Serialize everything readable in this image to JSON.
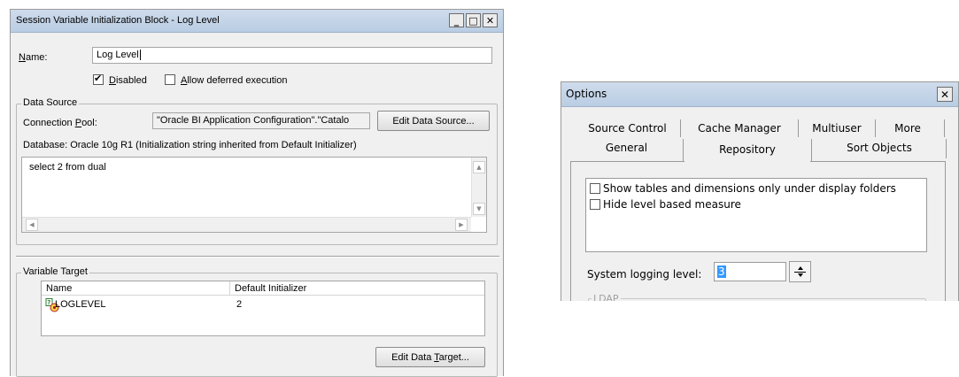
{
  "left_dialog": {
    "title": "Session Variable Initialization Block - Log Level",
    "name_label": "Name:",
    "name_value": "Log Level",
    "disabled_label": "Disabled",
    "disabled_checked": true,
    "deferred_label": "Allow deferred execution",
    "deferred_checked": false,
    "data_source": {
      "group_label": "Data Source",
      "connection_pool_label": "Connection Pool:",
      "connection_pool_value": "\"Oracle BI Application Configuration\".\"Catalo",
      "edit_button": "Edit Data Source...",
      "database_info": "Database: Oracle 10g R1 (Initialization string inherited from Default Initializer)",
      "sql_text": "select 2 from dual"
    },
    "variable_target": {
      "group_label": "Variable Target",
      "columns": [
        "Name",
        "Default Initializer"
      ],
      "rows": [
        {
          "name": "LOGLEVEL",
          "default_initializer": "2"
        }
      ],
      "edit_button": "Edit Data Target..."
    }
  },
  "right_dialog": {
    "title": "Options",
    "tabs_back": [
      "Source Control",
      "Cache Manager",
      "Multiuser",
      "More"
    ],
    "tabs_front": [
      "General",
      "Repository",
      "Sort Objects"
    ],
    "active_tab": "Repository",
    "options": [
      {
        "label": "Show tables and dimensions only under display folders",
        "checked": false
      },
      {
        "label": "Hide level based measure",
        "checked": false
      }
    ],
    "logging_label": "System logging level:",
    "logging_value": "3",
    "ldap_label": "LDAP"
  }
}
